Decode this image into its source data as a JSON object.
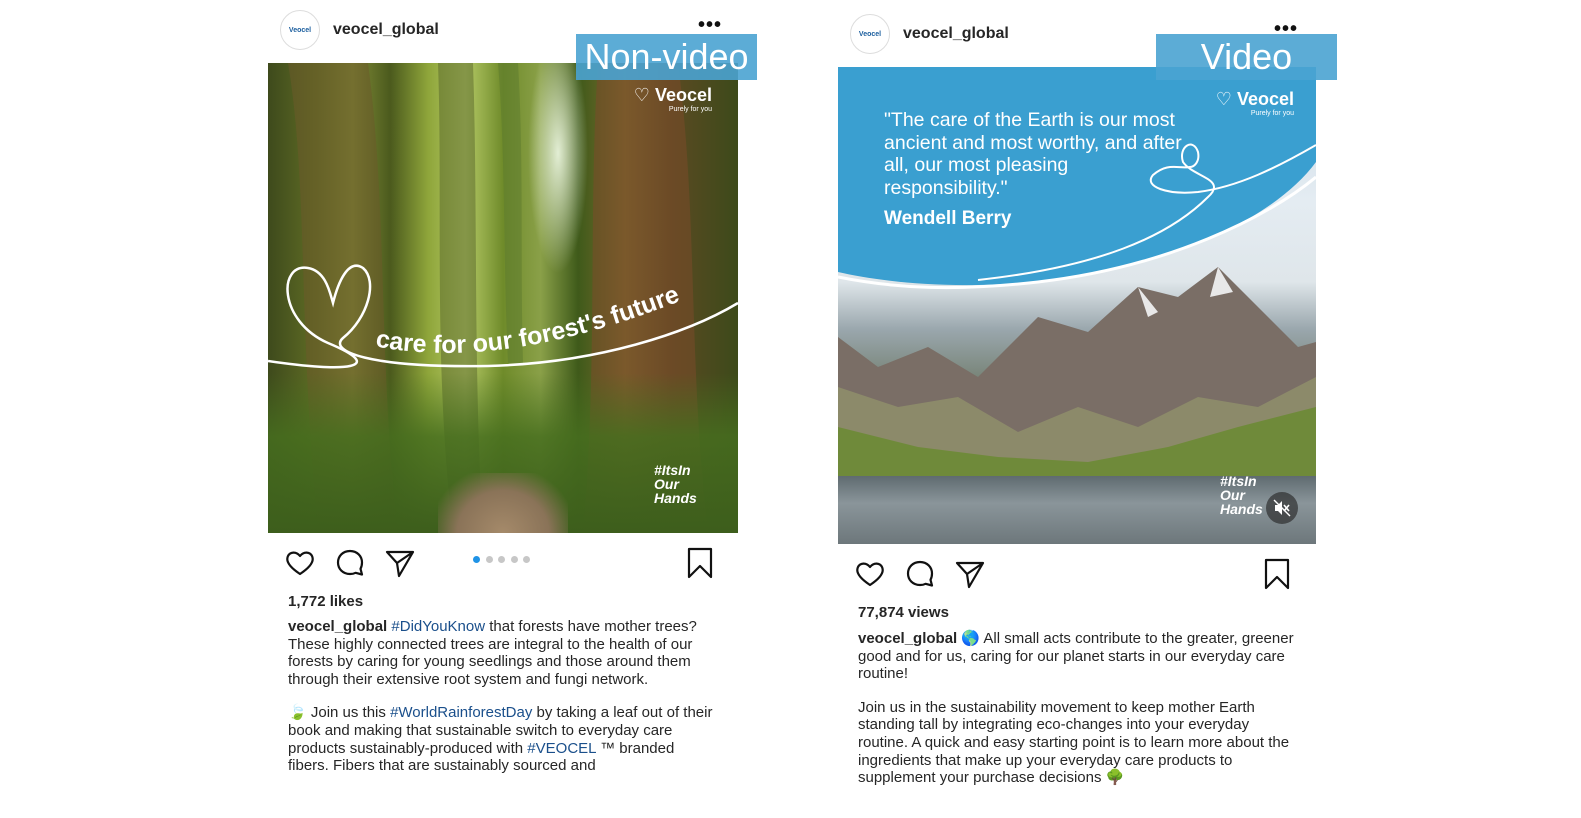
{
  "posts": [
    {
      "username": "veocel_global",
      "avatar_text": "Veocel",
      "more_label": "•••",
      "type_label": "Non-video",
      "media": {
        "brand": "Veocel",
        "brand_tagline": "Purely for you",
        "overlay_text": "care for our forest's future",
        "hashtag_logo": [
          "#ItsIn",
          "Our",
          "Hands"
        ]
      },
      "carousel_pages": 5,
      "carousel_active": 0,
      "count_text": "1,772 likes",
      "caption": {
        "p1_user": "veocel_global",
        "p1_tag": "#DidYouKnow",
        "p1_text": " that forests have mother trees? These highly connected trees are integral to the health of our forests by caring for young seedlings and those around them through their extensive root system and fungi network.",
        "p2_emoji": "🍃",
        "p2_text_a": " Join us this ",
        "p2_tag_a": "#WorldRainforestDay",
        "p2_text_b": " by taking a leaf out of their book and making that sustainable switch to everyday care products sustainably-produced with ",
        "p2_tag_b": "#VEOCEL",
        "p2_text_c": " ™ branded fibers. Fibers that are sustainably sourced and"
      }
    },
    {
      "username": "veocel_global",
      "avatar_text": "Veocel",
      "more_label": "•••",
      "type_label": "Video",
      "media": {
        "brand": "Veocel",
        "brand_tagline": "Purely for you",
        "quote": "\"The care of the Earth is our most ancient and most worthy, and after all, our most pleasing responsibility.\"",
        "quote_author": "Wendell Berry",
        "hashtag_logo": [
          "#ItsIn",
          "Our",
          "Hands"
        ]
      },
      "count_text": "77,874 views",
      "caption": {
        "p1_user": "veocel_global",
        "p1_text": " 🌎 All small acts contribute to the greater, greener good and for us, caring for our planet starts in our everyday care routine!",
        "p2_text": "Join us in the sustainability movement to keep mother Earth standing tall by integrating eco-changes into your everyday routine. A quick and easy starting point is to learn more about the ingredients that make up your everyday care products to supplement your purchase decisions 🌳"
      }
    }
  ],
  "colors": {
    "label_bg": "#4aa3d1",
    "banner_blue": "#3a9fd0",
    "hashtag_link": "#1a4f8b",
    "carousel_active": "#1f93e6"
  }
}
